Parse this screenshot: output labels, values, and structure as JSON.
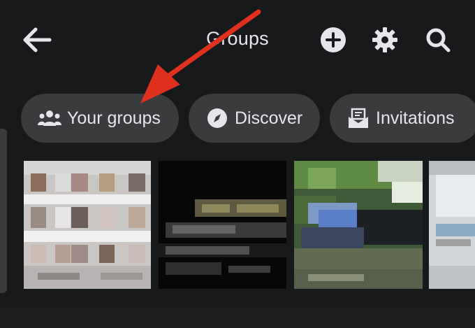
{
  "header": {
    "title": "Groups",
    "back_icon": "arrow-left-icon",
    "actions": [
      {
        "name": "add",
        "icon": "plus-circle-icon"
      },
      {
        "name": "settings",
        "icon": "gear-icon"
      },
      {
        "name": "search",
        "icon": "search-icon"
      }
    ]
  },
  "chips": [
    {
      "label": "Your groups",
      "icon": "people-icon"
    },
    {
      "label": "Discover",
      "icon": "compass-icon"
    },
    {
      "label": "Invitations",
      "icon": "envelope-icon"
    }
  ],
  "thumbnails": [
    {
      "name": "group-thumbnail-1",
      "blurred": true
    },
    {
      "name": "group-thumbnail-2",
      "blurred": true
    },
    {
      "name": "group-thumbnail-3",
      "blurred": true
    },
    {
      "name": "group-thumbnail-4",
      "blurred": true
    }
  ],
  "annotation": {
    "type": "red-arrow",
    "points_to": "Your groups",
    "color": "#e0301e"
  },
  "colors": {
    "background": "#18191a",
    "chip": "#3a3b3c",
    "text": "#e4e6eb"
  }
}
